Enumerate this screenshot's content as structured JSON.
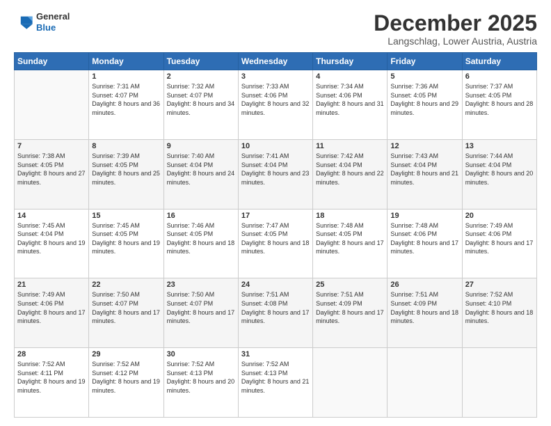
{
  "logo": {
    "general": "General",
    "blue": "Blue"
  },
  "header": {
    "month": "December 2025",
    "location": "Langschlag, Lower Austria, Austria"
  },
  "days_of_week": [
    "Sunday",
    "Monday",
    "Tuesday",
    "Wednesday",
    "Thursday",
    "Friday",
    "Saturday"
  ],
  "weeks": [
    [
      {
        "day": "",
        "sunrise": "",
        "sunset": "",
        "daylight": ""
      },
      {
        "day": "1",
        "sunrise": "Sunrise: 7:31 AM",
        "sunset": "Sunset: 4:07 PM",
        "daylight": "Daylight: 8 hours and 36 minutes."
      },
      {
        "day": "2",
        "sunrise": "Sunrise: 7:32 AM",
        "sunset": "Sunset: 4:07 PM",
        "daylight": "Daylight: 8 hours and 34 minutes."
      },
      {
        "day": "3",
        "sunrise": "Sunrise: 7:33 AM",
        "sunset": "Sunset: 4:06 PM",
        "daylight": "Daylight: 8 hours and 32 minutes."
      },
      {
        "day": "4",
        "sunrise": "Sunrise: 7:34 AM",
        "sunset": "Sunset: 4:06 PM",
        "daylight": "Daylight: 8 hours and 31 minutes."
      },
      {
        "day": "5",
        "sunrise": "Sunrise: 7:36 AM",
        "sunset": "Sunset: 4:05 PM",
        "daylight": "Daylight: 8 hours and 29 minutes."
      },
      {
        "day": "6",
        "sunrise": "Sunrise: 7:37 AM",
        "sunset": "Sunset: 4:05 PM",
        "daylight": "Daylight: 8 hours and 28 minutes."
      }
    ],
    [
      {
        "day": "7",
        "sunrise": "Sunrise: 7:38 AM",
        "sunset": "Sunset: 4:05 PM",
        "daylight": "Daylight: 8 hours and 27 minutes."
      },
      {
        "day": "8",
        "sunrise": "Sunrise: 7:39 AM",
        "sunset": "Sunset: 4:05 PM",
        "daylight": "Daylight: 8 hours and 25 minutes."
      },
      {
        "day": "9",
        "sunrise": "Sunrise: 7:40 AM",
        "sunset": "Sunset: 4:04 PM",
        "daylight": "Daylight: 8 hours and 24 minutes."
      },
      {
        "day": "10",
        "sunrise": "Sunrise: 7:41 AM",
        "sunset": "Sunset: 4:04 PM",
        "daylight": "Daylight: 8 hours and 23 minutes."
      },
      {
        "day": "11",
        "sunrise": "Sunrise: 7:42 AM",
        "sunset": "Sunset: 4:04 PM",
        "daylight": "Daylight: 8 hours and 22 minutes."
      },
      {
        "day": "12",
        "sunrise": "Sunrise: 7:43 AM",
        "sunset": "Sunset: 4:04 PM",
        "daylight": "Daylight: 8 hours and 21 minutes."
      },
      {
        "day": "13",
        "sunrise": "Sunrise: 7:44 AM",
        "sunset": "Sunset: 4:04 PM",
        "daylight": "Daylight: 8 hours and 20 minutes."
      }
    ],
    [
      {
        "day": "14",
        "sunrise": "Sunrise: 7:45 AM",
        "sunset": "Sunset: 4:04 PM",
        "daylight": "Daylight: 8 hours and 19 minutes."
      },
      {
        "day": "15",
        "sunrise": "Sunrise: 7:45 AM",
        "sunset": "Sunset: 4:05 PM",
        "daylight": "Daylight: 8 hours and 19 minutes."
      },
      {
        "day": "16",
        "sunrise": "Sunrise: 7:46 AM",
        "sunset": "Sunset: 4:05 PM",
        "daylight": "Daylight: 8 hours and 18 minutes."
      },
      {
        "day": "17",
        "sunrise": "Sunrise: 7:47 AM",
        "sunset": "Sunset: 4:05 PM",
        "daylight": "Daylight: 8 hours and 18 minutes."
      },
      {
        "day": "18",
        "sunrise": "Sunrise: 7:48 AM",
        "sunset": "Sunset: 4:05 PM",
        "daylight": "Daylight: 8 hours and 17 minutes."
      },
      {
        "day": "19",
        "sunrise": "Sunrise: 7:48 AM",
        "sunset": "Sunset: 4:06 PM",
        "daylight": "Daylight: 8 hours and 17 minutes."
      },
      {
        "day": "20",
        "sunrise": "Sunrise: 7:49 AM",
        "sunset": "Sunset: 4:06 PM",
        "daylight": "Daylight: 8 hours and 17 minutes."
      }
    ],
    [
      {
        "day": "21",
        "sunrise": "Sunrise: 7:49 AM",
        "sunset": "Sunset: 4:06 PM",
        "daylight": "Daylight: 8 hours and 17 minutes."
      },
      {
        "day": "22",
        "sunrise": "Sunrise: 7:50 AM",
        "sunset": "Sunset: 4:07 PM",
        "daylight": "Daylight: 8 hours and 17 minutes."
      },
      {
        "day": "23",
        "sunrise": "Sunrise: 7:50 AM",
        "sunset": "Sunset: 4:07 PM",
        "daylight": "Daylight: 8 hours and 17 minutes."
      },
      {
        "day": "24",
        "sunrise": "Sunrise: 7:51 AM",
        "sunset": "Sunset: 4:08 PM",
        "daylight": "Daylight: 8 hours and 17 minutes."
      },
      {
        "day": "25",
        "sunrise": "Sunrise: 7:51 AM",
        "sunset": "Sunset: 4:09 PM",
        "daylight": "Daylight: 8 hours and 17 minutes."
      },
      {
        "day": "26",
        "sunrise": "Sunrise: 7:51 AM",
        "sunset": "Sunset: 4:09 PM",
        "daylight": "Daylight: 8 hours and 18 minutes."
      },
      {
        "day": "27",
        "sunrise": "Sunrise: 7:52 AM",
        "sunset": "Sunset: 4:10 PM",
        "daylight": "Daylight: 8 hours and 18 minutes."
      }
    ],
    [
      {
        "day": "28",
        "sunrise": "Sunrise: 7:52 AM",
        "sunset": "Sunset: 4:11 PM",
        "daylight": "Daylight: 8 hours and 19 minutes."
      },
      {
        "day": "29",
        "sunrise": "Sunrise: 7:52 AM",
        "sunset": "Sunset: 4:12 PM",
        "daylight": "Daylight: 8 hours and 19 minutes."
      },
      {
        "day": "30",
        "sunrise": "Sunrise: 7:52 AM",
        "sunset": "Sunset: 4:13 PM",
        "daylight": "Daylight: 8 hours and 20 minutes."
      },
      {
        "day": "31",
        "sunrise": "Sunrise: 7:52 AM",
        "sunset": "Sunset: 4:13 PM",
        "daylight": "Daylight: 8 hours and 21 minutes."
      },
      {
        "day": "",
        "sunrise": "",
        "sunset": "",
        "daylight": ""
      },
      {
        "day": "",
        "sunrise": "",
        "sunset": "",
        "daylight": ""
      },
      {
        "day": "",
        "sunrise": "",
        "sunset": "",
        "daylight": ""
      }
    ]
  ]
}
